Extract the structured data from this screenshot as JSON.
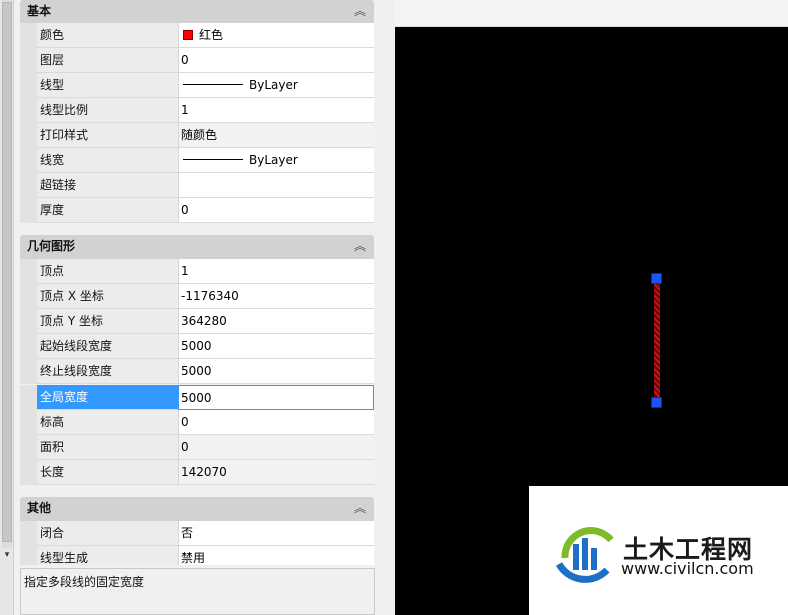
{
  "sections": {
    "basic": {
      "title": "基本",
      "rows": [
        {
          "label": "颜色",
          "value": "红色"
        },
        {
          "label": "图层",
          "value": "0"
        },
        {
          "label": "线型",
          "value": "ByLayer"
        },
        {
          "label": "线型比例",
          "value": "1"
        },
        {
          "label": "打印样式",
          "value": "随颜色"
        },
        {
          "label": "线宽",
          "value": "ByLayer"
        },
        {
          "label": "超链接",
          "value": ""
        },
        {
          "label": "厚度",
          "value": "0"
        }
      ]
    },
    "geometry": {
      "title": "几何图形",
      "rows": [
        {
          "label": "顶点",
          "value": "1"
        },
        {
          "label": "顶点 X 坐标",
          "value": "-1176340"
        },
        {
          "label": "顶点 Y 坐标",
          "value": "364280"
        },
        {
          "label": "起始线段宽度",
          "value": "5000"
        },
        {
          "label": "终止线段宽度",
          "value": "5000"
        },
        {
          "label": "全局宽度",
          "value": "5000"
        },
        {
          "label": "标高",
          "value": "0"
        },
        {
          "label": "面积",
          "value": "0"
        },
        {
          "label": "长度",
          "value": "142070"
        }
      ]
    },
    "other": {
      "title": "其他",
      "rows": [
        {
          "label": "闭合",
          "value": "否"
        },
        {
          "label": "线型生成",
          "value": "禁用"
        }
      ]
    }
  },
  "collapse_glyph": "︽",
  "scroll_down_glyph": "▾",
  "description": "指定多段线的固定宽度",
  "colors": {
    "selected_row": "#3399ff",
    "color_swatch": "#ff0000",
    "grip": "#1a55ff",
    "canvas": "#000000"
  },
  "watermark": {
    "title": "土木工程网",
    "url": "www.civilcn.com"
  }
}
